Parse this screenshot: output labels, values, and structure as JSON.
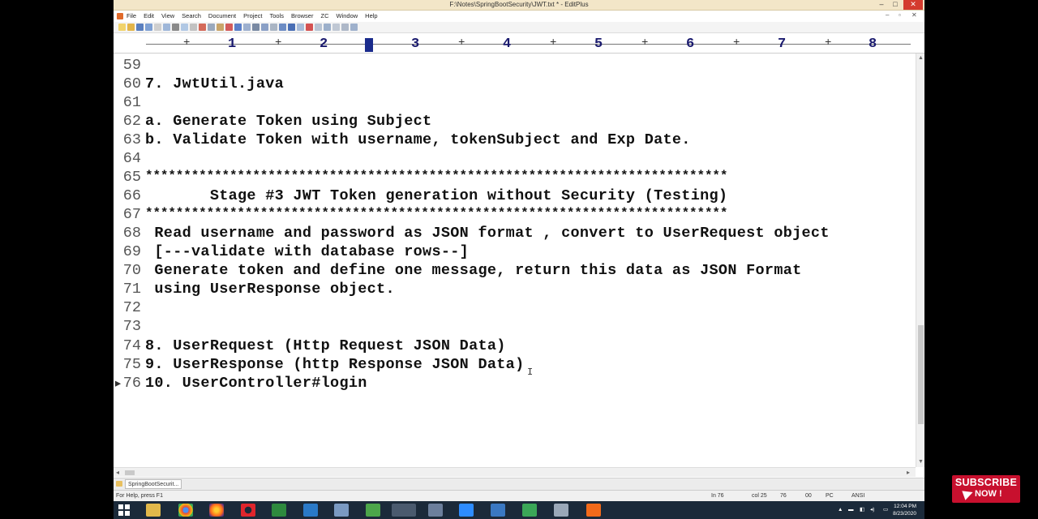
{
  "window": {
    "title": "F:\\Notes\\SpringBootSecurity\\JWT.txt * - EditPlus",
    "minimize": "–",
    "maximize": "□",
    "close": "✕"
  },
  "menu": {
    "items": [
      "File",
      "Edit",
      "View",
      "Search",
      "Document",
      "Project",
      "Tools",
      "Browser",
      "ZC",
      "Window",
      "Help"
    ],
    "mdi_controls": [
      "–",
      "▫",
      "✕"
    ]
  },
  "ruler": {
    "ticks": [
      "1",
      "2",
      "3",
      "4",
      "5",
      "6",
      "7",
      "8"
    ]
  },
  "editor": {
    "lines": [
      {
        "n": "59",
        "text": ""
      },
      {
        "n": "60",
        "text": "7. JwtUtil.java"
      },
      {
        "n": "61",
        "text": ""
      },
      {
        "n": "62",
        "text": "a. Generate Token using Subject"
      },
      {
        "n": "63",
        "text": "b. Validate Token with username, tokenSubject and Exp Date."
      },
      {
        "n": "64",
        "text": ""
      },
      {
        "n": "65",
        "text": "****************************************************************************"
      },
      {
        "n": "66",
        "text": "       Stage #3 JWT Token generation without Security (Testing)"
      },
      {
        "n": "67",
        "text": "****************************************************************************"
      },
      {
        "n": "68",
        "text": " Read username and password as JSON format , convert to UserRequest object"
      },
      {
        "n": "69",
        "text": " [---validate with database rows--]"
      },
      {
        "n": "70",
        "text": " Generate token and define one message, return this data as JSON Format"
      },
      {
        "n": "71",
        "text": " using UserResponse object."
      },
      {
        "n": "72",
        "text": ""
      },
      {
        "n": "73",
        "text": ""
      },
      {
        "n": "74",
        "text": "8. UserRequest (Http Request JSON Data)"
      },
      {
        "n": "75",
        "text": "9. UserResponse (http Response JSON Data)"
      },
      {
        "n": "76",
        "text": "10. UserController#login"
      }
    ],
    "current_line_marker": "▸"
  },
  "tabbar": {
    "document_tab": "SpringBootSecurit..."
  },
  "statusbar": {
    "help": "For Help, press F1",
    "line": "In 76",
    "col": "col 25",
    "value1": "76",
    "value2": "00",
    "mode": "PC",
    "encoding": "ANSI"
  },
  "taskbar": {
    "time": "12:04 PM",
    "date": "8/23/2020"
  },
  "overlay": {
    "subscribe_line1": "SUBSCRIBE",
    "subscribe_line2": "NOW !"
  },
  "colors": {
    "titlebar": "#f3e6c8",
    "ruler_numbers": "#1a1a6e",
    "taskbar": "#1b2a3a",
    "subscribe": "#c8102e"
  }
}
